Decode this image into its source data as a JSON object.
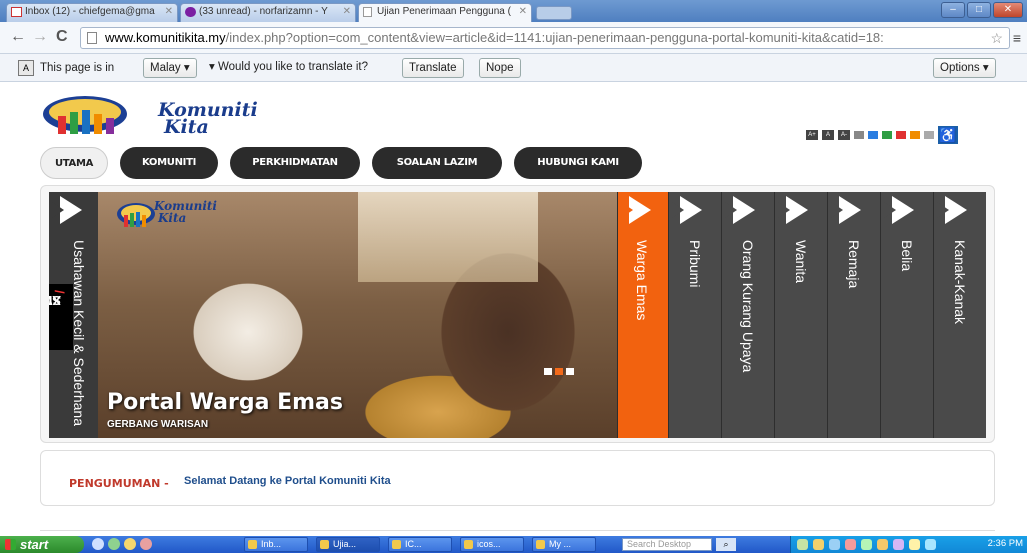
{
  "browser": {
    "tabs": [
      {
        "title": "Inbox (12) - chiefgema@gma"
      },
      {
        "title": "(33 unread) - norfarizamn - Y"
      },
      {
        "title": "Ujian Penerimaan Pengguna ("
      }
    ],
    "url_host": "www.komunitikita.my",
    "url_path": "/index.php?option=com_content&view=article&id=1141:ujian-penerimaan-pengguna-portal-komuniti-kita&catid=18:"
  },
  "translate_bar": {
    "prefix": "This page is in",
    "language": "Malay",
    "question": "Would you like to translate it?",
    "translate_label": "Translate",
    "nope_label": "Nope",
    "options_label": "Options"
  },
  "site": {
    "logo_line1": "Komuniti",
    "logo_line2": "Kita",
    "nav": [
      "UTAMA",
      "KOMUNITI",
      "PERKHIDMATAN",
      "SOALAN LAZIM",
      "HUBUNGI KAMI"
    ],
    "accessibility_colors": [
      "#888888",
      "#2a7de1",
      "#2f9e44",
      "#e03131",
      "#f08c00",
      "#aaaaaa"
    ],
    "slider": {
      "left_panel_label": "Usahawan Kecil & Sederhana",
      "xml_badge_a": "XML",
      "xml_badge_sep": "/",
      "xml_badge_b": "SWF",
      "photo_logo_line1": "Komuniti",
      "photo_logo_line2": "Kita",
      "caption_title": "Portal Warga Emas",
      "caption_subtitle": "GERBANG WARISAN",
      "panels": [
        {
          "label": "Warga Emas",
          "active": true
        },
        {
          "label": "Pribumi",
          "active": false
        },
        {
          "label": "Orang Kurang Upaya",
          "active": false
        },
        {
          "label": "Wanita",
          "active": false
        },
        {
          "label": "Remaja",
          "active": false
        },
        {
          "label": "Belia",
          "active": false
        },
        {
          "label": "Kanak-Kanak",
          "active": false
        }
      ]
    },
    "announcement_label": "PENGUMUMAN -",
    "announcement_text": "Selamat Datang ke Portal Komuniti Kita"
  },
  "taskbar": {
    "start_label": "start",
    "items": [
      "Inb...",
      "Ujia...",
      "IC...",
      "icos...",
      "My ..."
    ],
    "search_placeholder": "Search Desktop",
    "clock": "2:36 PM"
  }
}
